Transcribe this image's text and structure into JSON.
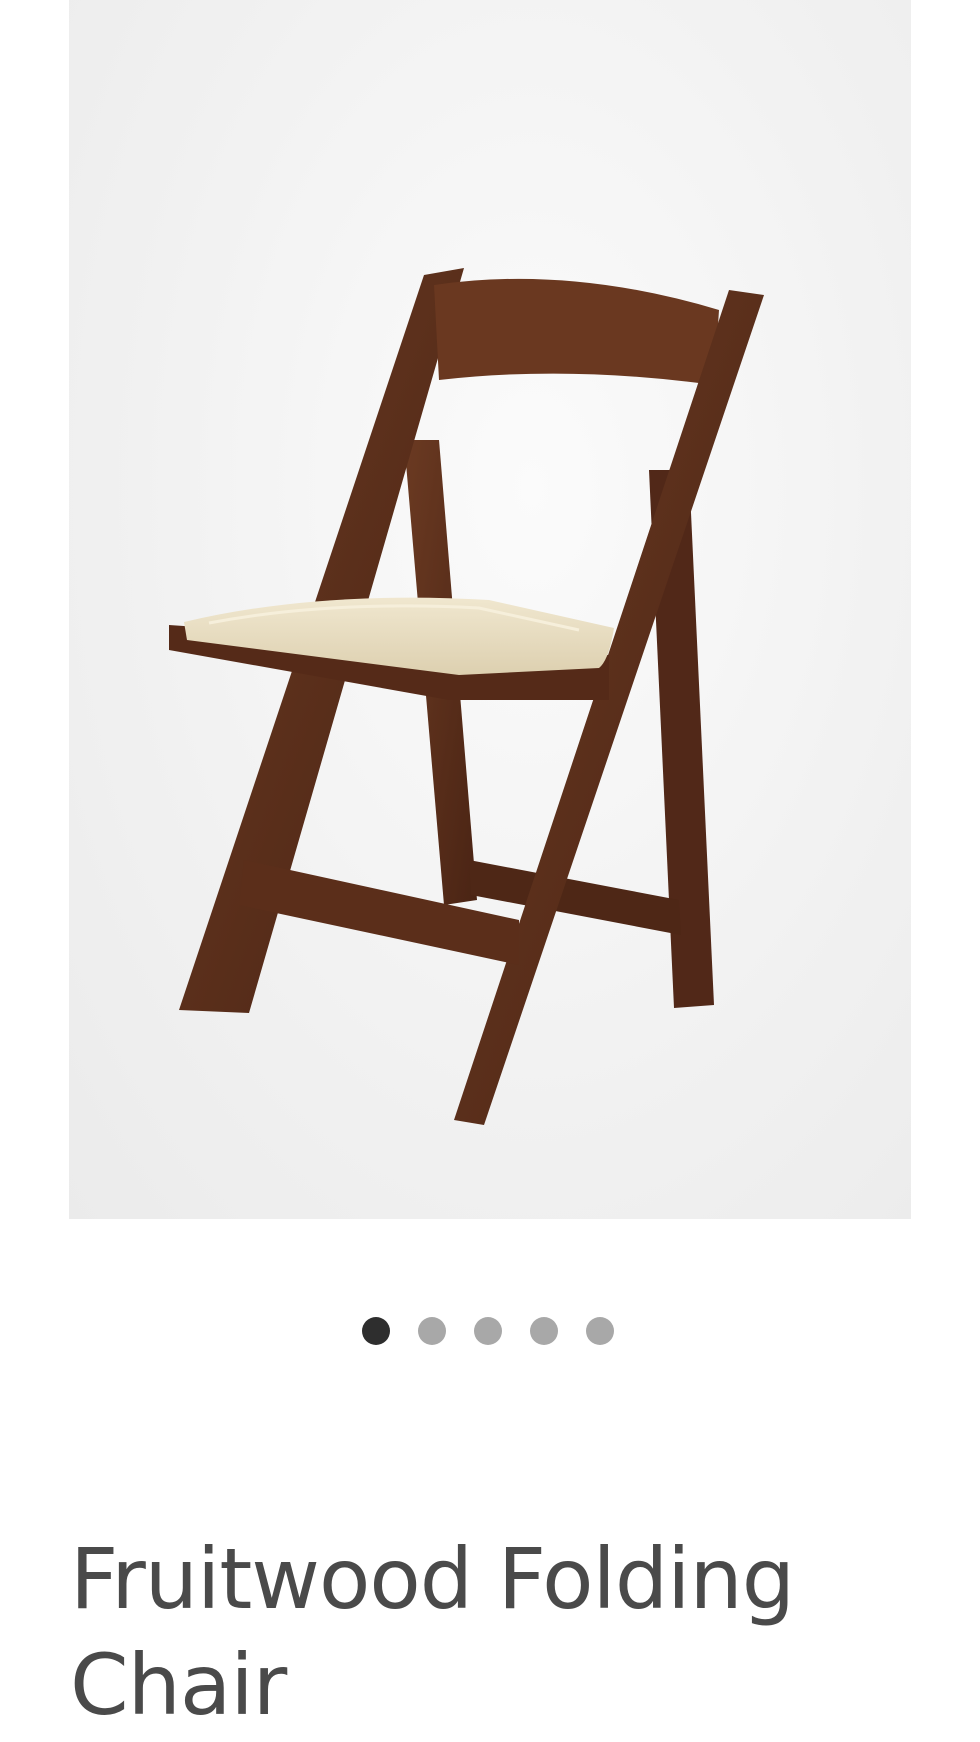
{
  "product": {
    "title": "Fruitwood Folding Chair",
    "image_subject": "fruitwood folding chair with ivory seat pad"
  },
  "carousel": {
    "total_slides": 5,
    "active_index": 0
  },
  "colors": {
    "title_text": "#4a4a4a",
    "dot_active": "#2e2e2e",
    "dot_inactive": "#a8a8a8",
    "wood": "#5a2e1a",
    "seat_pad": "#e9dfc6"
  }
}
